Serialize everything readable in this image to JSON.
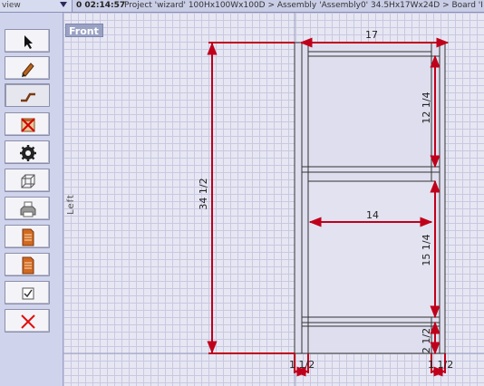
{
  "topbar": {
    "view_menu_label": "view",
    "elapsed_time": "0 02:14:57",
    "breadcrumb": "Project 'wizard' 100Hx100Wx100D > Assembly 'Assembly0' 34.5Hx17Wx24D > Board 'I"
  },
  "toolbar": {
    "tools": [
      {
        "name": "select-tool",
        "icon": "cursor-arrow-icon"
      },
      {
        "name": "pencil-tool",
        "icon": "pencil-icon"
      },
      {
        "name": "line-tool",
        "icon": "stair-line-icon"
      },
      {
        "name": "delete-board-tool",
        "icon": "crossed-box-icon"
      },
      {
        "name": "rotate-tool",
        "icon": "gear-icon"
      },
      {
        "name": "3d-view-tool",
        "icon": "cube-wireframe-icon"
      },
      {
        "name": "print-tool",
        "icon": "printer-icon"
      },
      {
        "name": "document-tool",
        "icon": "document-icon"
      },
      {
        "name": "document-tool-2",
        "icon": "document-icon"
      },
      {
        "name": "check-tool",
        "icon": "checkbox-icon"
      },
      {
        "name": "close-tool",
        "icon": "red-x-icon"
      }
    ],
    "active_index": 2
  },
  "canvas": {
    "view_tab": "Front",
    "side_label": "Left",
    "dimensions": {
      "overall_width": "17",
      "overall_height": "34 1/2",
      "upper_opening": "12 1/4",
      "lower_opening": "15 1/4",
      "inner_width": "14",
      "toe_kick": "2 1/2",
      "left_side_thickness": "1 1/2",
      "right_side_thickness": "1 1/2"
    }
  },
  "colors": {
    "dimension_line": "#c0001a",
    "drawing_line": "#333333",
    "canvas_bg": "#e7e7f4",
    "grid": "#c8c8e0"
  }
}
